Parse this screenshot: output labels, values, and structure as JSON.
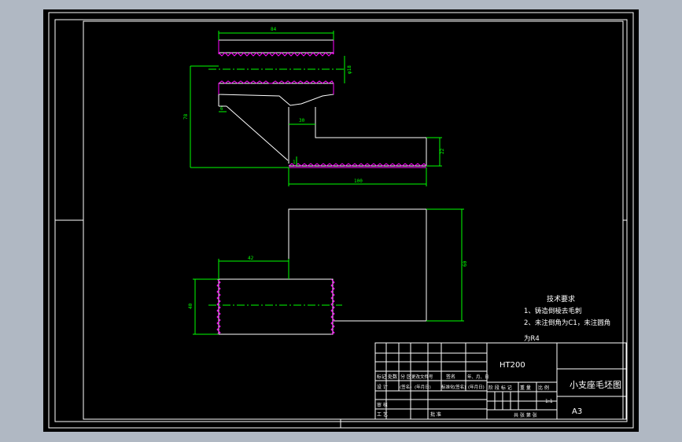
{
  "drawing": {
    "dimensions": {
      "top_width": "84",
      "bore": "φ18",
      "height": "78",
      "small_left": "6",
      "step_width": "30",
      "right_height": "22",
      "bottom_length": "100",
      "tiny": "1",
      "front_width": "42",
      "front_right_height": "60",
      "front_left_height": "40"
    },
    "tech_req": {
      "title": "技术要求",
      "line1": "1、铸造倒棱去毛刺",
      "line2": "2、未注倒角为C1，未注圆角",
      "line3": "为R4"
    },
    "title_block": {
      "material": "HT200",
      "part_name": "小支座毛坯图",
      "scale": "1:1",
      "sheet_size": "A3",
      "header_row": [
        "标记",
        "处数",
        "分 区",
        "更改文件号",
        "签名",
        "年、月、日"
      ],
      "design_row": [
        "设 计",
        "(签名)",
        "(年月日)",
        "标准化",
        "(签名)",
        "(年月日)"
      ],
      "stage_labels": [
        "阶 段 标 记",
        "重 量",
        "比 例"
      ],
      "review_label": "审 核",
      "process_label": "工 艺",
      "approve_label": "批 准",
      "sheets_label": "共  张  第  张"
    }
  }
}
